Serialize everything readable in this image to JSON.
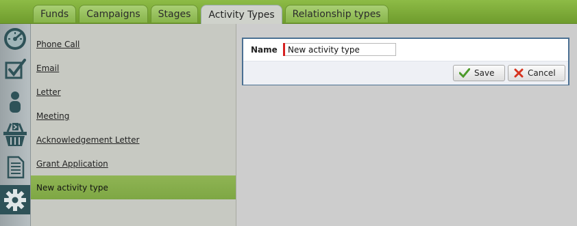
{
  "tabs": [
    {
      "label": "Funds"
    },
    {
      "label": "Campaigns"
    },
    {
      "label": "Stages"
    },
    {
      "label": "Activity Types",
      "active": true
    },
    {
      "label": "Relationship types"
    }
  ],
  "rail": [
    {
      "icon": "dashboard-icon"
    },
    {
      "icon": "task-check-icon"
    },
    {
      "icon": "person-icon"
    },
    {
      "icon": "donation-basket-icon"
    },
    {
      "icon": "document-icon"
    },
    {
      "icon": "gear-icon",
      "active": true
    }
  ],
  "activity_types": [
    {
      "label": "Phone Call"
    },
    {
      "label": "Email"
    },
    {
      "label": "Letter"
    },
    {
      "label": "Meeting"
    },
    {
      "label": "Acknowledgement Letter"
    },
    {
      "label": "Grant Application"
    },
    {
      "label": "New activity type",
      "selected": true
    }
  ],
  "form": {
    "name_label": "Name",
    "name_value": "New activity type",
    "save_label": "Save",
    "cancel_label": "Cancel"
  },
  "colors": {
    "accent_green": "#7ea744",
    "required_red": "#d62020",
    "form_border": "#4a6f92"
  }
}
